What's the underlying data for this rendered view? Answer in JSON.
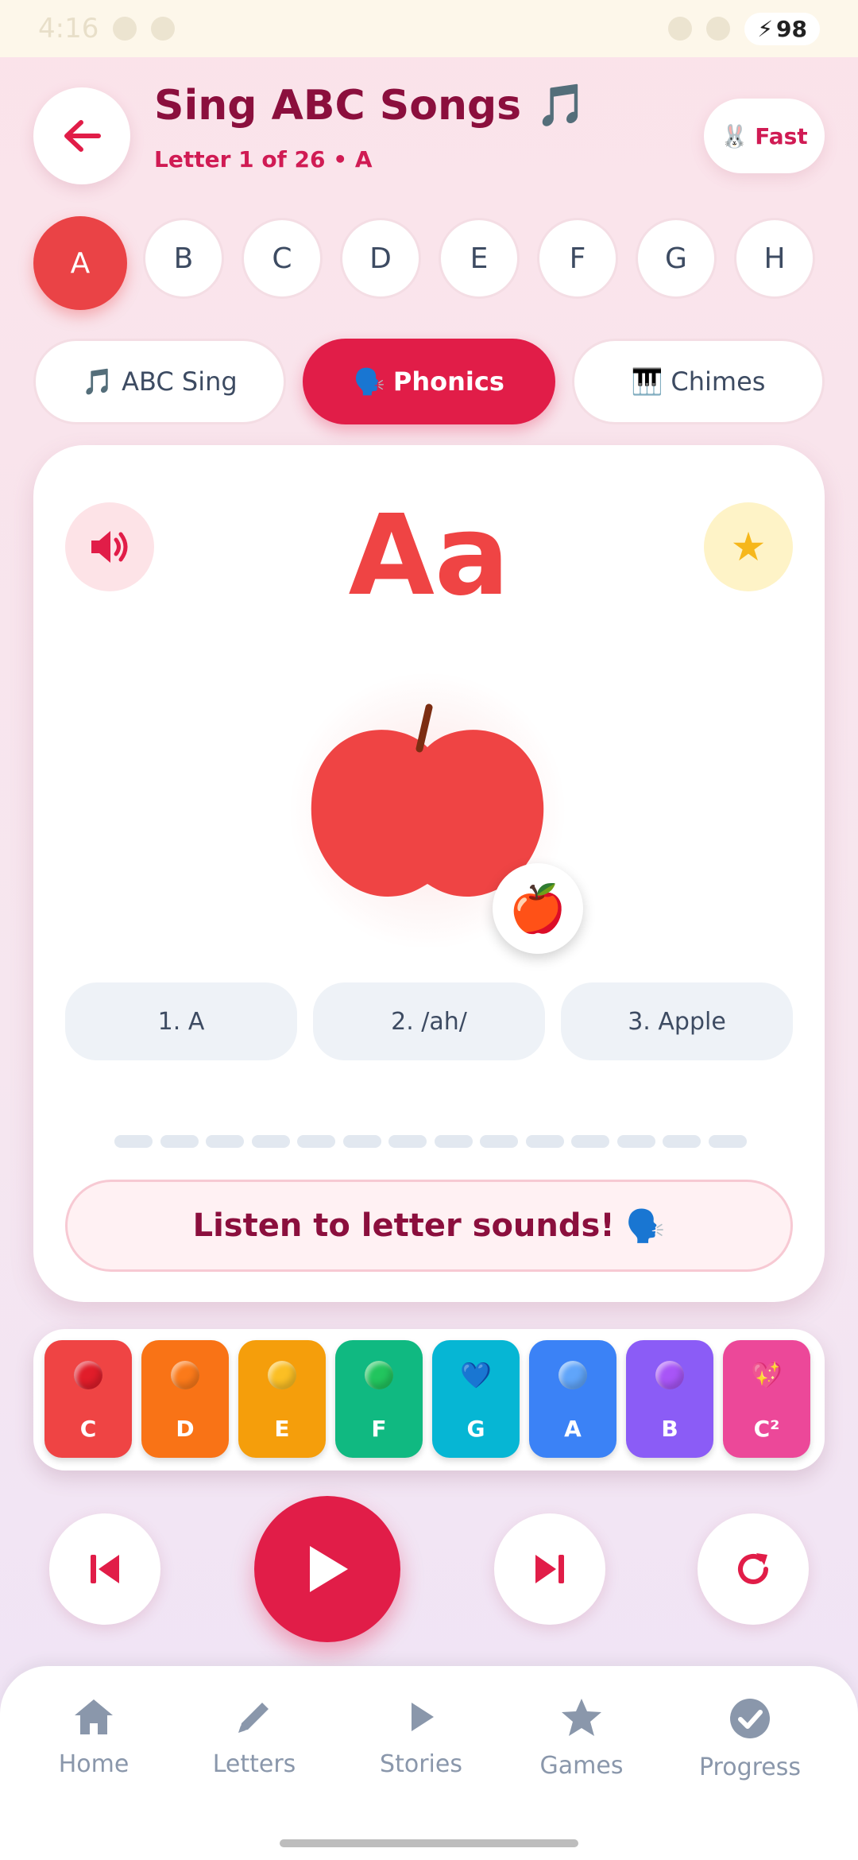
{
  "status_bar": {
    "time": "4:16",
    "battery": "98"
  },
  "header": {
    "title": "Sing ABC Songs 🎵",
    "subtitle": "Letter 1 of 26 • A",
    "speed_label": "Fast",
    "speed_emoji": "🐰"
  },
  "letters": [
    "A",
    "B",
    "C",
    "D",
    "E",
    "F",
    "G",
    "H"
  ],
  "selected_letter": "A",
  "modes": [
    {
      "emoji": "🎵",
      "label": "ABC Sing"
    },
    {
      "emoji": "🗣️",
      "label": "Phonics"
    },
    {
      "emoji": "🎹",
      "label": "Chimes"
    }
  ],
  "active_mode": "Phonics",
  "card": {
    "big_letter": "Aa",
    "emoji": "🍎",
    "steps": [
      "1. A",
      "2. /ah/",
      "3. Apple"
    ],
    "progress_segments": 14,
    "message": "Listen to letter sounds!",
    "message_emoji": "🗣️"
  },
  "chimes": [
    {
      "note": "C",
      "color": "#ef4444",
      "dot": "#e11d2a"
    },
    {
      "note": "D",
      "color": "#f97316",
      "dot": "#fb7a1a"
    },
    {
      "note": "E",
      "color": "#f59e0b",
      "dot": "#fbbf24"
    },
    {
      "note": "F",
      "color": "#10b981",
      "dot": "#22c55e"
    },
    {
      "note": "G",
      "color": "#06b6d4",
      "dot": "#67e8f9",
      "icon": "💙"
    },
    {
      "note": "A",
      "color": "#3b82f6",
      "dot": "#60a5fa"
    },
    {
      "note": "B",
      "color": "#8b5cf6",
      "dot": "#a855f7"
    },
    {
      "note": "C²",
      "color": "#ec4899",
      "dot": "#f472b6",
      "icon": "💖"
    }
  ],
  "nav": [
    "Home",
    "Letters",
    "Stories",
    "Games",
    "Progress"
  ],
  "colors": {
    "accent": "#e11d48",
    "title": "#8b0f3d",
    "apple": "#ef4444"
  }
}
